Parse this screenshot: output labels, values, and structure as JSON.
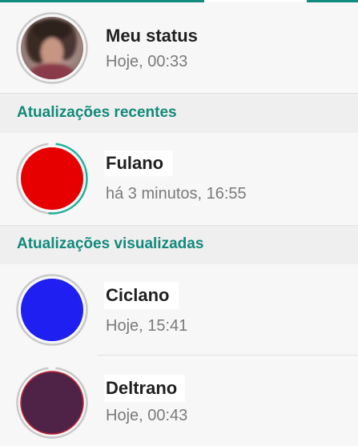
{
  "colors": {
    "accent": "#12897b",
    "ring_unseen": "#25b09a",
    "ring_seen": "#c9c9c9",
    "fulano_avatar": "#e60000",
    "ciclano_avatar": "#1f1ff2",
    "deltrano_avatar": "#4f2347"
  },
  "my_status": {
    "title": "Meu status",
    "time": "Hoje, 00:33",
    "icon": "user-photo"
  },
  "sections": {
    "recent": "Atualizações recentes",
    "viewed": "Atualizações visualizadas"
  },
  "recent_updates": [
    {
      "name": "Fulano",
      "time": "há 3 minutos, 16:55"
    }
  ],
  "viewed_updates": [
    {
      "name": "Ciclano",
      "time": "Hoje, 15:41"
    },
    {
      "name": "Deltrano",
      "time": "Hoje, 00:43"
    }
  ]
}
